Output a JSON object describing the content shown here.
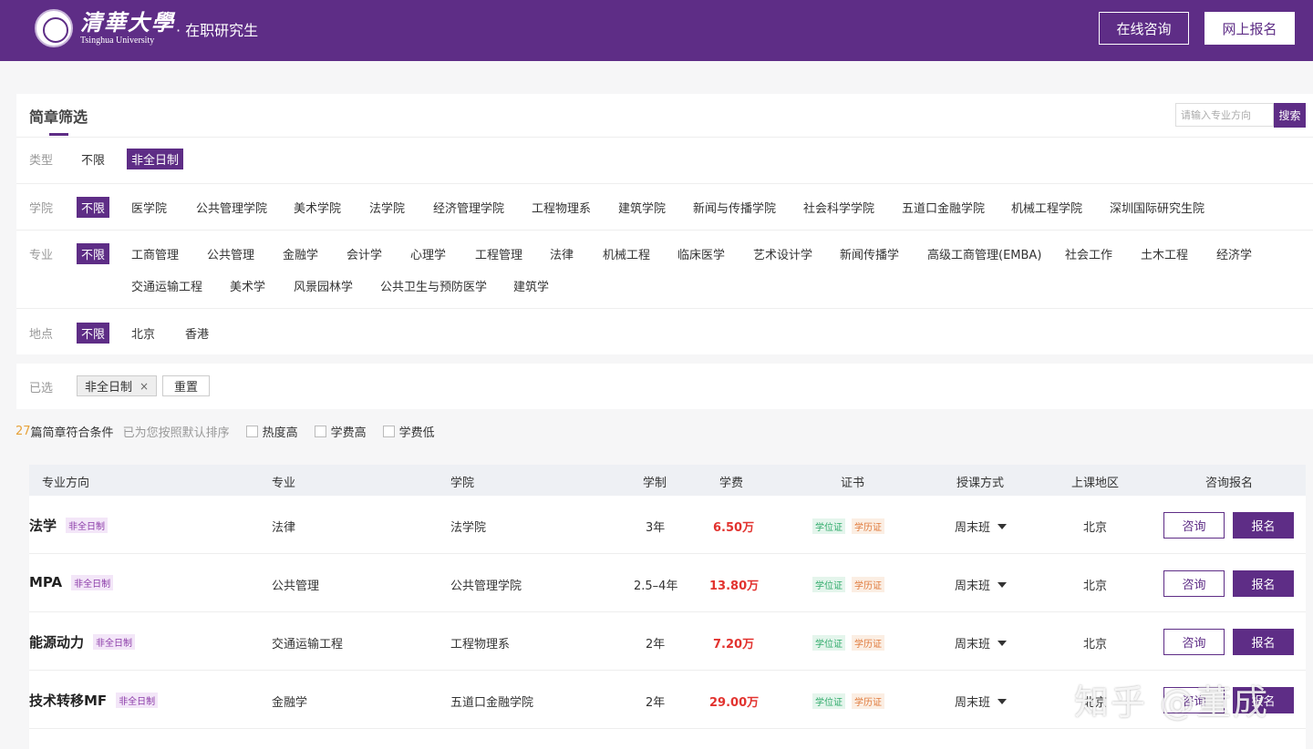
{
  "header": {
    "logo_cn": "清華大學",
    "logo_en": "Tsinghua University",
    "sub_title": "· 在职研究生",
    "consult_label": "在线咨询",
    "signup_label": "网上报名",
    "bg_color": "#5e2d86"
  },
  "filter": {
    "title": "简章筛选",
    "search_placeholder": "请输入专业方向",
    "search_label": "搜索",
    "type": {
      "label": "类型",
      "options": [
        "不限",
        "非全日制"
      ],
      "active": "非全日制"
    },
    "college": {
      "label": "学院",
      "options": [
        "不限",
        "医学院",
        "公共管理学院",
        "美术学院",
        "法学院",
        "经济管理学院",
        "工程物理系",
        "建筑学院",
        "新闻与传播学院",
        "社会科学学院",
        "五道口金融学院",
        "机械工程学院",
        "深圳国际研究生院"
      ],
      "active": "不限"
    },
    "major": {
      "label": "专业",
      "options": [
        "不限",
        "工商管理",
        "公共管理",
        "金融学",
        "会计学",
        "心理学",
        "工程管理",
        "法律",
        "机械工程",
        "临床医学",
        "艺术设计学",
        "新闻传播学",
        "高级工商管理(EMBA)",
        "社会工作",
        "土木工程",
        "经济学",
        "交通运输工程",
        "美术学",
        "风景园林学",
        "公共卫生与预防医学",
        "建筑学"
      ],
      "active": "不限"
    },
    "location": {
      "label": "地点",
      "options": [
        "不限",
        "北京",
        "香港"
      ],
      "active": "不限"
    }
  },
  "selected": {
    "label": "已选",
    "tags": [
      "非全日制"
    ],
    "remove_icon": "×",
    "reset_label": "重置"
  },
  "sort": {
    "count": "27",
    "count_text": "篇简章符合条件",
    "hint": "已为您按照默认排序",
    "options": [
      "热度高",
      "学费高",
      "学费低"
    ]
  },
  "table": {
    "headers": [
      "专业方向",
      "专业",
      "学院",
      "学制",
      "学费",
      "证书",
      "授课方式",
      "上课地区",
      "咨询报名"
    ],
    "rows": [
      {
        "direction": "法学",
        "badge": "非全日制",
        "major": "法律",
        "college": "法学院",
        "duration": "3年",
        "fee": "6.50万",
        "cert1": "学位证",
        "cert2": "学历证",
        "mode": "周末班",
        "location": "北京",
        "consult": "咨询",
        "signup": "报名"
      },
      {
        "direction": "MPA",
        "badge": "非全日制",
        "major": "公共管理",
        "college": "公共管理学院",
        "duration": "2.5–4年",
        "fee": "13.80万",
        "cert1": "学位证",
        "cert2": "学历证",
        "mode": "周末班",
        "location": "北京",
        "consult": "咨询",
        "signup": "报名"
      },
      {
        "direction": "能源动力",
        "badge": "非全日制",
        "major": "交通运输工程",
        "college": "工程物理系",
        "duration": "2年",
        "fee": "7.20万",
        "cert1": "学位证",
        "cert2": "学历证",
        "mode": "周末班",
        "location": "北京",
        "consult": "咨询",
        "signup": "报名"
      },
      {
        "direction": "技术转移MF",
        "badge": "非全日制",
        "major": "金融学",
        "college": "五道口金融学院",
        "duration": "2年",
        "fee": "29.00万",
        "cert1": "学位证",
        "cert2": "学历证",
        "mode": "周末班",
        "location": "北京",
        "consult": "咨询",
        "signup": "报名"
      }
    ]
  },
  "watermark": "知乎 @董成"
}
